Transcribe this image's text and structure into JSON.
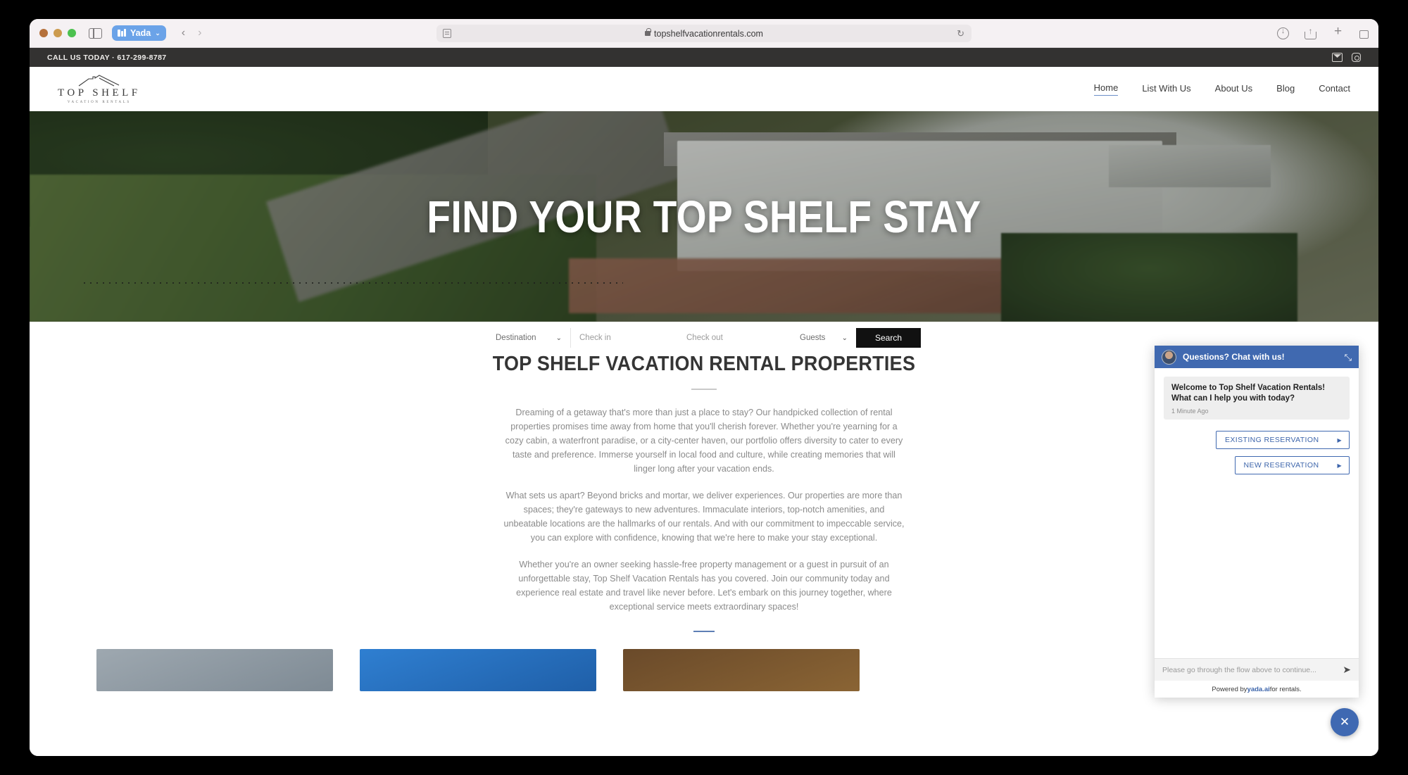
{
  "browser": {
    "tab_label": "Yada",
    "url": "topshelfvacationrentals.com",
    "back_glyph": "‹",
    "forward_glyph": "›",
    "reload_glyph": "↻"
  },
  "topbar": {
    "call_text": "CALL US TODAY · 617-299-8787"
  },
  "logo": {
    "name": "TOP SHELF",
    "sub": "VACATION RENTALS"
  },
  "nav": {
    "items": [
      {
        "label": "Home",
        "active": true
      },
      {
        "label": "List With Us",
        "active": false
      },
      {
        "label": "About Us",
        "active": false
      },
      {
        "label": "Blog",
        "active": false
      },
      {
        "label": "Contact",
        "active": false
      }
    ]
  },
  "hero": {
    "title": "FIND YOUR TOP SHELF STAY",
    "search": {
      "destination_label": "Destination",
      "checkin_placeholder": "Check in",
      "checkout_placeholder": "Check out",
      "guests_label": "Guests",
      "search_label": "Search",
      "caret_glyph": "⌄"
    }
  },
  "section": {
    "title": "TOP SHELF VACATION RENTAL PROPERTIES",
    "paragraphs": [
      "Dreaming of a getaway that's more than just a place to stay? Our handpicked collection of rental properties promises time away from home that you'll cherish forever. Whether you're yearning for a cozy cabin, a waterfront paradise, or a city-center haven, our portfolio offers diversity to cater to every taste and preference. Immerse yourself in local food and culture, while creating memories that will linger long after your vacation ends.",
      "What sets us apart? Beyond bricks and mortar, we deliver experiences. Our properties are more than spaces; they're gateways to new adventures. Immaculate interiors, top-notch amenities, and unbeatable locations are the hallmarks of our rentals. And with our commitment to impeccable service, you can explore with confidence, knowing that we're here to make your stay exceptional.",
      "Whether you're an owner seeking hassle-free property management or a guest in pursuit of an unforgettable stay, Top Shelf Vacation Rentals has you covered. Join our community today and experience real estate and travel like never before. Let's embark on this journey together, where exceptional service meets extraordinary spaces!"
    ]
  },
  "chat": {
    "title": "Questions? Chat with us!",
    "minimize_glyph": "⤡",
    "message": "Welcome to Top Shelf Vacation Rentals! What can I help you with today?",
    "message_time": "1 Minute Ago",
    "quick_replies": [
      {
        "label": "EXISTING RESERVATION",
        "arrow": "▶"
      },
      {
        "label": "NEW RESERVATION",
        "arrow": "▶"
      }
    ],
    "input_placeholder": "Please go through the flow above to continue...",
    "send_glyph": "➤",
    "footer_prefix": "Powered by ",
    "footer_link": "yada.ai",
    "footer_suffix": " for rentals.",
    "fab_glyph": "✕",
    "accent_color": "#4069b0"
  }
}
